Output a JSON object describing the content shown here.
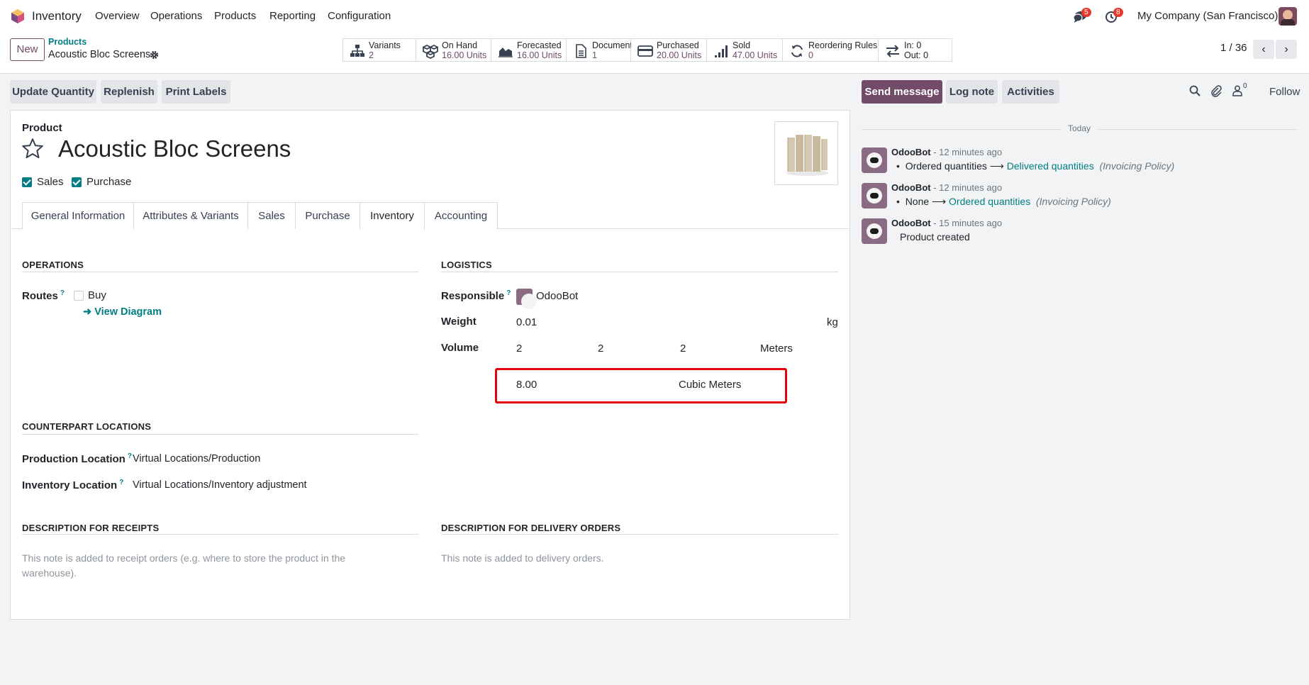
{
  "navbar": {
    "app_name": "Inventory",
    "menus": [
      "Overview",
      "Operations",
      "Products",
      "Reporting",
      "Configuration"
    ],
    "messages_badge": "5",
    "activities_badge": "8",
    "company": "My Company (San Francisco)"
  },
  "control": {
    "new_label": "New",
    "breadcrumb_parent": "Products",
    "breadcrumb_current": "Acoustic Bloc Screens",
    "stats": [
      {
        "label": "Variants",
        "value": "2",
        "icon": "variants-icon"
      },
      {
        "label": "On Hand",
        "value": "16.00 Units",
        "icon": "cubes-icon"
      },
      {
        "label": "Forecasted",
        "value": "16.00 Units",
        "icon": "area-chart-icon"
      },
      {
        "label": "Documents",
        "value": "1",
        "icon": "document-icon"
      },
      {
        "label": "Purchased",
        "value": "20.00 Units",
        "icon": "credit-card-icon"
      },
      {
        "label": "Sold",
        "value": "47.00 Units",
        "icon": "signal-icon"
      },
      {
        "label": "Reordering Rules",
        "value": "0",
        "icon": "refresh-icon"
      },
      {
        "label": "In: 0",
        "value": "Out: 0",
        "icon": "exchange-icon"
      }
    ],
    "pager": "1 / 36"
  },
  "actions": {
    "update_quantity": "Update Quantity",
    "replenish": "Replenish",
    "print_labels": "Print Labels"
  },
  "form": {
    "product_label": "Product",
    "product_name": "Acoustic Bloc Screens",
    "sales_label": "Sales",
    "purchase_label": "Purchase",
    "tabs": [
      "General Information",
      "Attributes & Variants",
      "Sales",
      "Purchase",
      "Inventory",
      "Accounting"
    ],
    "operations_title": "OPERATIONS",
    "routes_label": "Routes",
    "route_buy": "Buy",
    "view_diagram": "View Diagram",
    "logistics_title": "LOGISTICS",
    "responsible_label": "Responsible",
    "responsible_value": "OdooBot",
    "weight_label": "Weight",
    "weight_value": "0.01",
    "weight_unit": "kg",
    "volume_label": "Volume",
    "volume_l": "2",
    "volume_w": "2",
    "volume_h": "2",
    "volume_dim_unit": "Meters",
    "volume_total": "8.00",
    "volume_total_unit": "Cubic Meters",
    "counterpart_title": "COUNTERPART LOCATIONS",
    "production_location_label": "Production Location",
    "production_location_value": "Virtual Locations/Production",
    "inventory_location_label": "Inventory Location",
    "inventory_location_value": "Virtual Locations/Inventory adjustment",
    "desc_receipts_title": "DESCRIPTION FOR RECEIPTS",
    "desc_receipts_placeholder": "This note is added to receipt orders (e.g. where to store the product in the warehouse).",
    "desc_delivery_title": "DESCRIPTION FOR DELIVERY ORDERS",
    "desc_delivery_placeholder": "This note is added to delivery orders."
  },
  "chatter": {
    "send_message": "Send message",
    "log_note": "Log note",
    "activities": "Activities",
    "followers_count": "0",
    "follow": "Follow",
    "date_separator": "Today",
    "messages": [
      {
        "author": "OdooBot",
        "time": "- 12 minutes ago",
        "old": "Ordered quantities",
        "new": "Delivered quantities",
        "field": "(Invoicing Policy)"
      },
      {
        "author": "OdooBot",
        "time": "- 12 minutes ago",
        "old": "None",
        "new": "Ordered quantities",
        "field": "(Invoicing Policy)"
      },
      {
        "author": "OdooBot",
        "time": "- 15 minutes ago",
        "body": "Product created"
      }
    ]
  },
  "colors": {
    "brand": "#714b67",
    "link": "#017e84",
    "highlight": "#e3000f"
  }
}
